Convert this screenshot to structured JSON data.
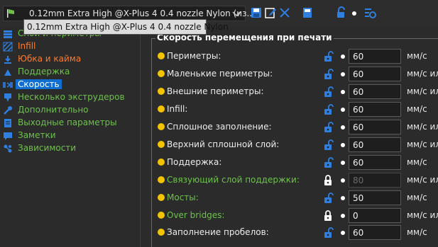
{
  "toolbar": {
    "preset_value": "0.12mm Extra High @X-Plus 4 0.4 nozzle Nylon (из...",
    "tooltip": "0.12mm Extra High @X-Plus 4 0.4 nozzle Nylon",
    "icons": [
      "flag-icon",
      "chevron-down-icon",
      "save-icon",
      "rename-icon",
      "delete-icon",
      "compare-icon",
      "lock-icon",
      "dot-icon",
      "settings-gear-icon"
    ]
  },
  "nav": {
    "items": [
      {
        "label": "Слои и периметры",
        "color": "#6dc24b",
        "icon": "layers-icon"
      },
      {
        "label": "Infill",
        "color": "#ff7a2b",
        "icon": "infill-icon"
      },
      {
        "label": "Юбка и кайма",
        "color": "#ff7a2b",
        "icon": "skirt-icon"
      },
      {
        "label": "Поддержка",
        "color": "#6dc24b",
        "icon": "support-icon"
      },
      {
        "label": "Скорость",
        "color": "#ffffff",
        "icon": "speed-icon",
        "selected": true
      },
      {
        "label": "Несколько экструдеров",
        "color": "#6dc24b",
        "icon": "extruder-icon"
      },
      {
        "label": "Дополнительно",
        "color": "#6dc24b",
        "icon": "wrench-icon"
      },
      {
        "label": "Выходные параметры",
        "color": "#6dc24b",
        "icon": "output-icon"
      },
      {
        "label": "Заметки",
        "color": "#6dc24b",
        "icon": "notes-icon"
      },
      {
        "label": "Зависимости",
        "color": "#6dc24b",
        "icon": "dependencies-icon"
      }
    ]
  },
  "group": {
    "title": "Скорость перемещения при печати",
    "rows": [
      {
        "label": "Периметры:",
        "value": "60",
        "unit": "мм/с",
        "locked": false,
        "color": "#ececec"
      },
      {
        "label": "Маленькие периметры:",
        "value": "60",
        "unit": "мм/с ил",
        "locked": false,
        "color": "#ececec"
      },
      {
        "label": "Внешние периметры:",
        "value": "60",
        "unit": "мм/с ил",
        "locked": false,
        "color": "#ececec"
      },
      {
        "label": "Infill:",
        "value": "60",
        "unit": "мм/с",
        "locked": false,
        "color": "#ececec"
      },
      {
        "label": "Сплошное заполнение:",
        "value": "60",
        "unit": "мм/с ил",
        "locked": false,
        "color": "#ececec"
      },
      {
        "label": "Верхний сплошной слой:",
        "value": "60",
        "unit": "мм/с ил",
        "locked": false,
        "color": "#ececec"
      },
      {
        "label": "Поддержка:",
        "value": "60",
        "unit": "мм/с",
        "locked": false,
        "color": "#ececec"
      },
      {
        "label": "Связующий слой поддержки:",
        "value": "80",
        "unit": "мм/с ил",
        "locked": true,
        "color": "#6dc24b",
        "disabled": true
      },
      {
        "label": "Мосты:",
        "value": "50",
        "unit": "мм/с",
        "locked": false,
        "color": "#6dc24b"
      },
      {
        "label": "Over bridges:",
        "value": "0",
        "unit": "мм/с ил",
        "locked": true,
        "color": "#6dc24b"
      },
      {
        "label": "Заполнение пробелов:",
        "value": "60",
        "unit": "мм/с",
        "locked": false,
        "color": "#ececec"
      }
    ]
  },
  "colors": {
    "accent": "#0f6fd1",
    "lock_open": "#2f7fe0",
    "lock_closed": "#ffffff",
    "bullet": "#f2c400",
    "modified": "#6dc24b",
    "system": "#ff7a2b"
  }
}
